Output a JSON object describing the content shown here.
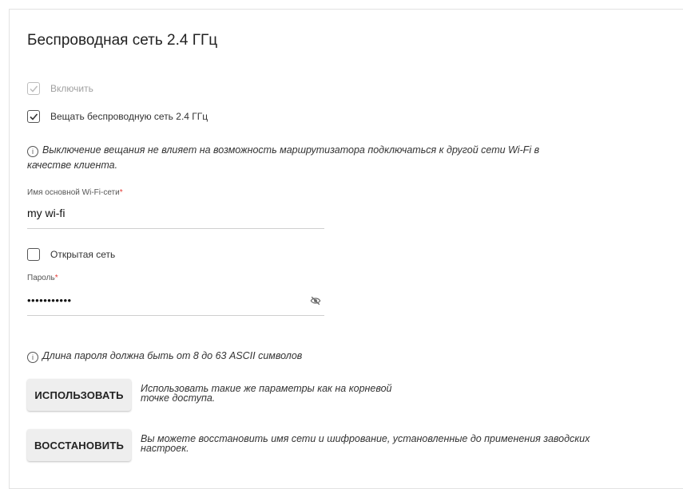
{
  "section": {
    "title": "Беспроводная сеть 2.4 ГГц"
  },
  "checkboxes": {
    "enable": {
      "label": "Включить",
      "checked": true,
      "disabled": true
    },
    "broadcast": {
      "label": "Вещать беспроводную сеть 2.4 ГГц",
      "checked": true,
      "disabled": false
    },
    "open_network": {
      "label": "Открытая сеть",
      "checked": false,
      "disabled": false
    }
  },
  "info": {
    "broadcast_note_line1": "Выключение вещания не влияет на возможность маршрутизатора подключаться к другой сети Wi-Fi в",
    "broadcast_note_line2": "качестве клиента.",
    "password_note": "Длина пароля должна быть от 8 до 63 ASCII символов"
  },
  "ssid": {
    "label": "Имя основной Wi-Fi-сети",
    "required_mark": "*",
    "value": "my wi-fi"
  },
  "password": {
    "label": "Пароль",
    "required_mark": "*",
    "value": "•••••••••••",
    "visibility_icon": "eye-off-icon"
  },
  "buttons": {
    "use": {
      "label": "ИСПОЛЬЗОВАТЬ",
      "desc_line1": "Использовать такие же параметры как на корневой",
      "desc_line2": "точке доступа."
    },
    "restore": {
      "label": "ВОССТАНОВИТЬ",
      "desc_line1": "Вы можете восстановить имя сети и шифрование, установленные до применения заводских",
      "desc_line2": "настроек."
    }
  },
  "colors": {
    "required": "#e53935",
    "button_bg": "#eeeeee",
    "divider": "#cfcfcf"
  }
}
